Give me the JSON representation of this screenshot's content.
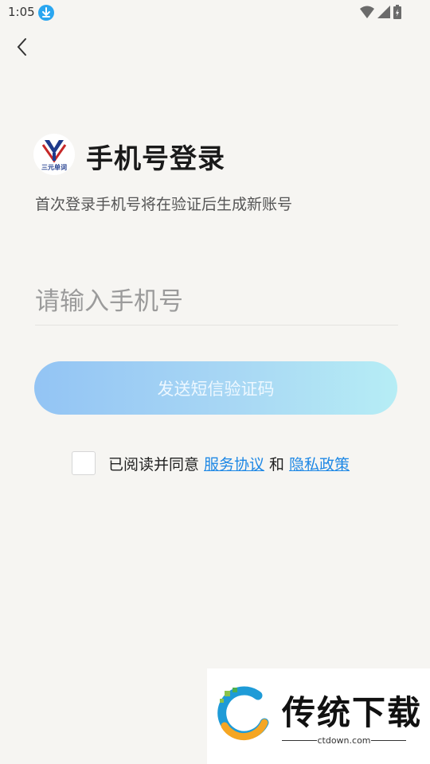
{
  "status_bar": {
    "time": "1:05"
  },
  "header": {
    "title": "手机号登录",
    "subtitle": "首次登录手机号将在验证后生成新账号"
  },
  "logo": {
    "text": "三元单词"
  },
  "form": {
    "phone_placeholder": "请输入手机号",
    "phone_value": "",
    "send_button_label": "发送短信验证码"
  },
  "agreement": {
    "prefix": "已阅读并同意",
    "service_link": "服务协议",
    "and": "和",
    "privacy_link": "隐私政策",
    "checked": false
  },
  "watermark": {
    "title": "传统下载",
    "url": "ctdown.com"
  },
  "colors": {
    "accent": "#1e88e5",
    "button_start": "#93c4f4",
    "button_end": "#b6edf5",
    "background": "#f6f5f2"
  }
}
